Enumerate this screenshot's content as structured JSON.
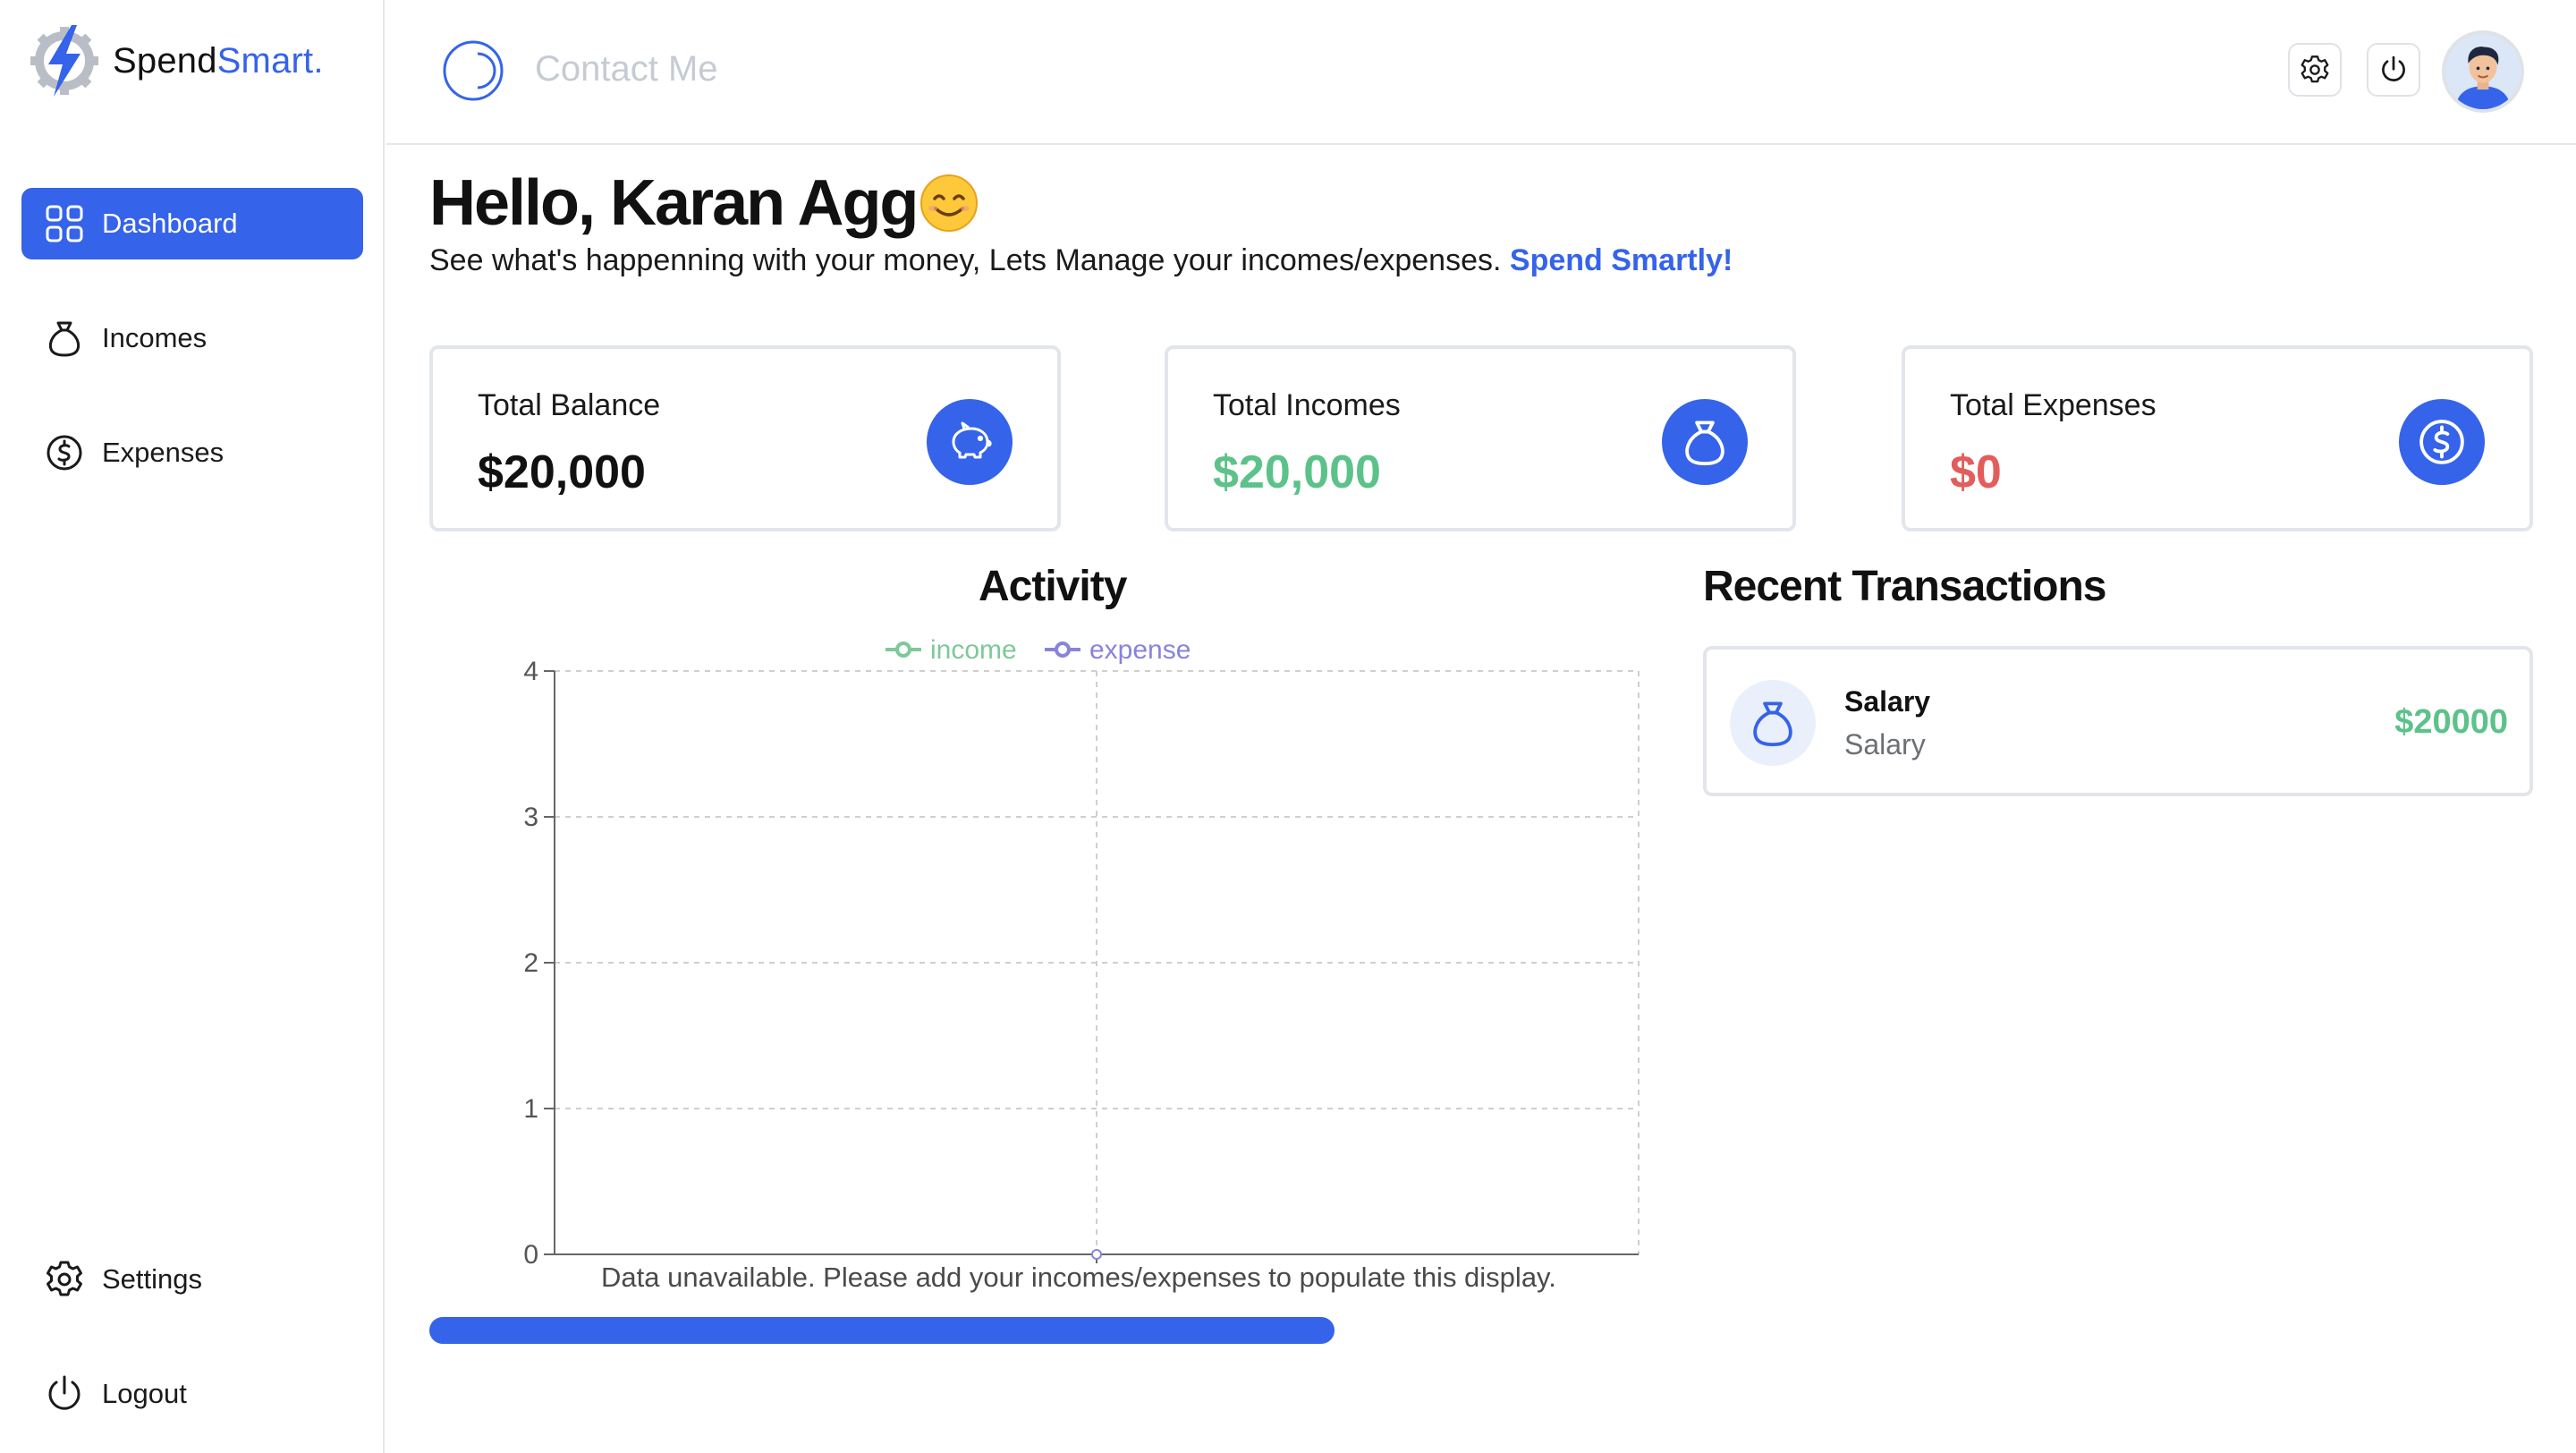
{
  "app": {
    "brand_part1": "Spend",
    "brand_part2": "Smart."
  },
  "sidebar": {
    "items": [
      {
        "label": "Dashboard",
        "icon": "grid-icon",
        "active": true
      },
      {
        "label": "Incomes",
        "icon": "money-bag-icon"
      },
      {
        "label": "Expenses",
        "icon": "dollar-circle-icon"
      }
    ],
    "bottom": [
      {
        "label": "Settings",
        "icon": "gear-icon"
      },
      {
        "label": "Logout",
        "icon": "power-icon"
      }
    ]
  },
  "header": {
    "contact": "Contact Me"
  },
  "main": {
    "greeting": "Hello, Karan Agg",
    "subtitle": "See what's happenning with your money, Lets Manage your incomes/expenses.",
    "subtitle_accent": "Spend Smartly!"
  },
  "cards": [
    {
      "title": "Total Balance",
      "symbol": "$",
      "value": "20,000",
      "color": "#111111",
      "icon": "piggy-bank-icon"
    },
    {
      "title": "Total Incomes",
      "symbol": "$",
      "value": "20,000",
      "color": "#5cc28a",
      "icon": "money-bag-icon"
    },
    {
      "title": "Total Expenses",
      "symbol": "$",
      "value": "0",
      "color": "#e35d5d",
      "icon": "dollar-circle-icon"
    }
  ],
  "activity": {
    "title": "Activity",
    "empty_message": "Data unavailable. Please add your incomes/expenses to populate this display."
  },
  "chart_data": {
    "type": "line",
    "title": "Activity",
    "series": [
      {
        "name": "income",
        "color": "#7ec89a",
        "values": []
      },
      {
        "name": "expense",
        "color": "#8884d8",
        "values": []
      }
    ],
    "ylim": [
      0,
      4
    ],
    "yticks": [
      "0",
      "1",
      "2",
      "3",
      "4"
    ],
    "grid": true,
    "legend": "top-center"
  },
  "transactions": {
    "title": "Recent Transactions",
    "items": [
      {
        "name": "Salary",
        "category": "Salary",
        "amount": "$20000"
      }
    ]
  },
  "colors": {
    "primary": "#3563e9",
    "income": "#5cc28a",
    "expense": "#e35d5d"
  }
}
